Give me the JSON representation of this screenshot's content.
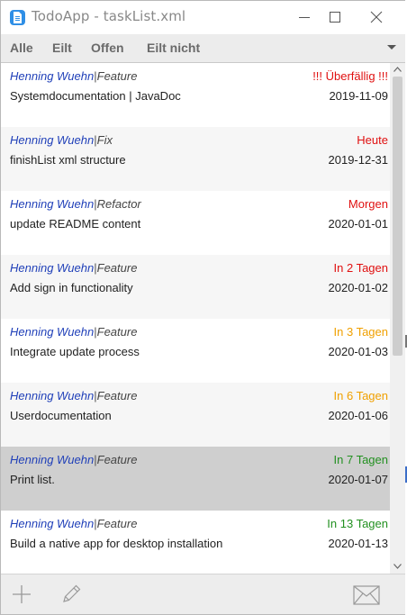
{
  "window": {
    "app_name": "TodoApp",
    "separator": " - ",
    "file_name": "taskList.xml",
    "icon": "document-icon"
  },
  "filters": [
    {
      "label": "Alle"
    },
    {
      "label": "Eilt"
    },
    {
      "label": "Offen"
    },
    {
      "label": "Eilt nicht"
    }
  ],
  "colors": {
    "author": "#1f3fb8",
    "overdue": "#e01010",
    "soon_red": "#e01010",
    "soon_orange": "#f0a000",
    "later_green": "#229020",
    "selected_row": "#cfcfcf"
  },
  "tasks": [
    {
      "author": "Henning Wuehn",
      "sep": "|",
      "type": "Feature",
      "status": "!!! Überfällig !!!",
      "status_color": "#e01010",
      "title": "Systemdocumentation | JavaDoc",
      "date": "2019-11-09"
    },
    {
      "author": "Henning Wuehn",
      "sep": "|",
      "type": "Fix",
      "status": "Heute",
      "status_color": "#e01010",
      "title": "finishList xml structure",
      "date": "2019-12-31"
    },
    {
      "author": "Henning Wuehn",
      "sep": "|",
      "type": "Refactor",
      "status": "Morgen",
      "status_color": "#e01010",
      "title": "update README content",
      "date": "2020-01-01"
    },
    {
      "author": "Henning Wuehn",
      "sep": "|",
      "type": "Feature",
      "status": "In 2 Tagen",
      "status_color": "#e01010",
      "title": "Add sign in functionality",
      "date": "2020-01-02"
    },
    {
      "author": "Henning Wuehn",
      "sep": "|",
      "type": "Feature",
      "status": "In 3 Tagen",
      "status_color": "#f0a000",
      "title": "Integrate update process",
      "date": "2020-01-03"
    },
    {
      "author": "Henning Wuehn",
      "sep": "|",
      "type": "Feature",
      "status": "In 6 Tagen",
      "status_color": "#f0a000",
      "title": "Userdocumentation",
      "date": "2020-01-06"
    },
    {
      "author": "Henning Wuehn",
      "sep": "|",
      "type": "Feature",
      "status": "In 7 Tagen",
      "status_color": "#229020",
      "title": "Print list.",
      "date": "2020-01-07",
      "selected": true
    },
    {
      "author": "Henning Wuehn",
      "sep": "|",
      "type": "Feature",
      "status": "In 13 Tagen",
      "status_color": "#229020",
      "title": "Build a native app for desktop installation",
      "date": "2020-01-13"
    }
  ],
  "toolbar": {
    "add_icon": "plus-icon",
    "edit_icon": "pencil-icon",
    "mail_icon": "envelope-icon"
  }
}
